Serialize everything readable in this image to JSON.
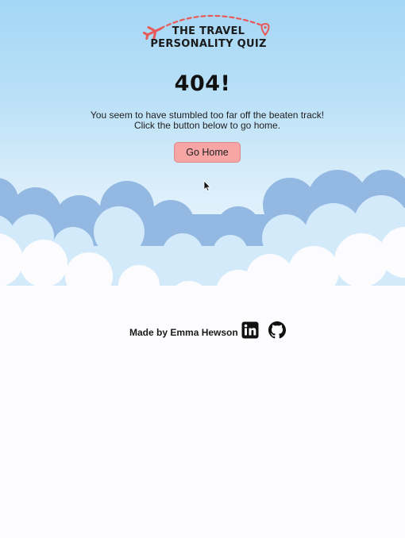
{
  "logo": {
    "line1": "THE TRAVEL",
    "line2": "PERSONALITY QUIZ",
    "accent_color": "#e85a5a",
    "icons": [
      "airplane-icon",
      "map-pin-icon"
    ]
  },
  "error": {
    "title": "404!",
    "message_line1": "You seem to have stumbled too far off the beaten track!",
    "message_line2": "Click the button below to go home."
  },
  "actions": {
    "go_home_label": "Go Home",
    "button_color": "#f7a5a5"
  },
  "footer": {
    "credit": "Made by Emma Hewson",
    "links": [
      {
        "icon": "linkedin-icon"
      },
      {
        "icon": "github-icon"
      }
    ]
  },
  "colors": {
    "sky_top": "#a4d6f5",
    "cloud_back": "#93b9e2",
    "cloud_mid": "#d3eafb",
    "cloud_front": "#fcfcfe"
  }
}
